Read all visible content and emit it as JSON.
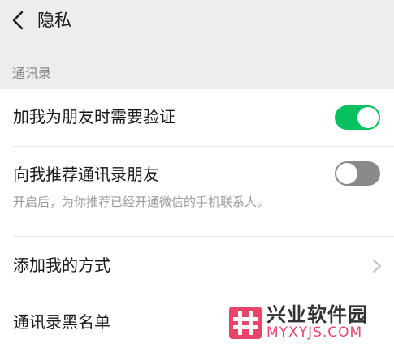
{
  "header": {
    "title": "隐私",
    "back_icon": "chevron-left-icon"
  },
  "section": {
    "label": "通讯录"
  },
  "rows": [
    {
      "title": "加我为朋友时需要验证",
      "control": "toggle",
      "enabled": true
    },
    {
      "title": "向我推荐通讯录朋友",
      "description": "开启后，为你推荐已经开通微信的手机联系人。",
      "control": "toggle",
      "enabled": false
    },
    {
      "title": "添加我的方式",
      "control": "chevron-right-icon"
    },
    {
      "title": "通讯录黑名单"
    }
  ],
  "watermark": {
    "name": "兴业软件园",
    "domain": "MYXYJS.COM"
  },
  "colors": {
    "accent": "#07c160",
    "toggle_off": "#8a8a8a",
    "watermark_pink": "#e8456b"
  }
}
